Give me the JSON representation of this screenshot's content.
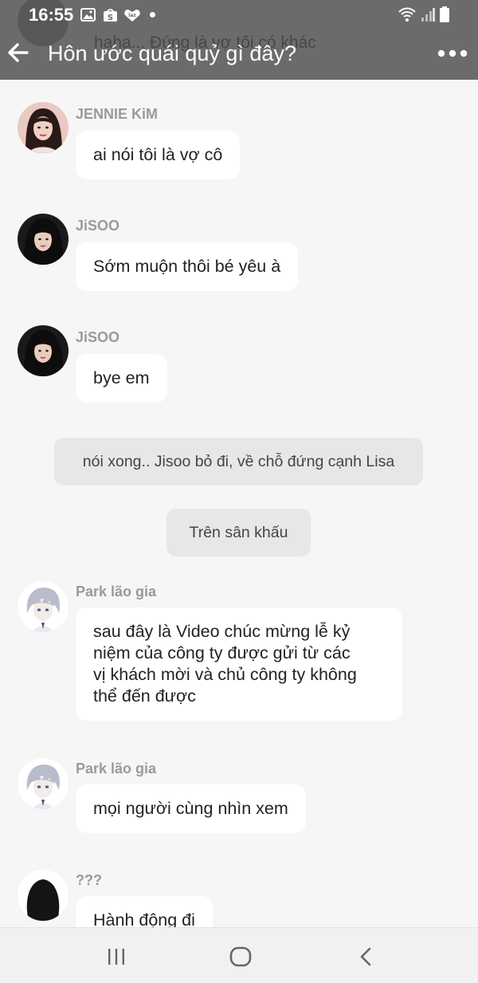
{
  "status_bar": {
    "time": "16:55",
    "app_icons": [
      "gallery-icon",
      "shopee-icon",
      "lazada-icon",
      "dot-icon"
    ],
    "system_icons": [
      "wifi-icon",
      "signal-icon",
      "battery-icon"
    ]
  },
  "header": {
    "title": "Hôn ước quái quỷ gì đây?",
    "ghost_preview_text": "haha... Đúng là vợ tôi có khác",
    "back_icon": "back-arrow-icon",
    "more_icon": "more-options-icon"
  },
  "messages": [
    {
      "sender": "JENNIE KiM",
      "text": "ai nói tôi là vợ cô"
    },
    {
      "sender": "JiSOO",
      "text": "Sớm muộn thôi bé yêu à"
    },
    {
      "sender": "JiSOO",
      "text": "bye em"
    },
    {
      "sender": "Park lão gia",
      "lines": [
        "sau đây là Video chúc mừng lễ kỷ",
        "niệm của công ty được gửi từ các",
        "vị khách mời và chủ công ty không",
        "thể đến được"
      ]
    },
    {
      "sender": "Park lão gia",
      "text": "mọi người cùng nhìn xem"
    },
    {
      "sender": "???",
      "text": "Hành động đi"
    }
  ],
  "narrations": [
    "nói xong.. Jisoo bỏ đi, về chỗ đứng cạnh Lisa",
    "Trên sân khấu"
  ],
  "nav_bar": {
    "icons": [
      "recent-apps-icon",
      "home-icon",
      "back-nav-icon"
    ]
  }
}
